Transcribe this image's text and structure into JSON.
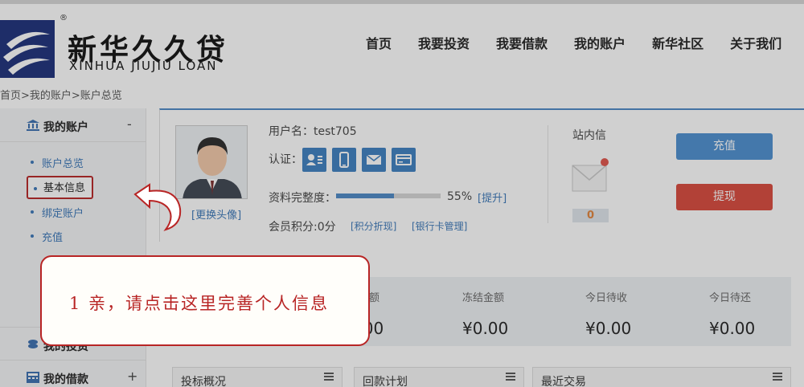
{
  "header": {
    "logo_cn": "新华久久贷",
    "logo_en": "XINHUA JIUJIU LOAN",
    "logo_reg": "®",
    "nav": [
      "首页",
      "我要投资",
      "我要借款",
      "我的账户",
      "新华社区",
      "关于我们"
    ]
  },
  "breadcrumb": "首页>我的账户>账户总览",
  "sidebar": {
    "section_account": "我的账户",
    "section_account_toggle": "-",
    "items": [
      "账户总览",
      "基本信息",
      "绑定账户",
      "充值"
    ],
    "section_invest": "我的投资",
    "section_loan": "我的借款",
    "section_loan_toggle": "+"
  },
  "profile": {
    "username": "用户名：test705",
    "auth_label": "认证：",
    "change_avatar": "[更换头像]",
    "complete_label": "资料完整度：",
    "complete_pct": "55%",
    "complete_value": 0.55,
    "complete_link": "[提升]",
    "points": "会员积分:0分",
    "link_points": "[积分折现]",
    "link_bank": "[银行卡管理]"
  },
  "messages": {
    "label": "站内信",
    "count": "0"
  },
  "buttons": {
    "recharge": "充值",
    "withdraw": "提现"
  },
  "stats": [
    {
      "label": "可用余额",
      "value": "¥0.00"
    },
    {
      "label": "冻结金额",
      "value": "¥0.00"
    },
    {
      "label": "今日待收",
      "value": "¥0.00"
    },
    {
      "label": "今日待还",
      "value": "¥0.00"
    }
  ],
  "boxes": [
    "投标概况",
    "回款计划",
    "最近交易"
  ],
  "note": {
    "text": "1 亲，请点击这里完善个人信息"
  },
  "colors": {
    "primary": "#4c8fd0",
    "danger": "#d9483b",
    "annotation": "#b82525"
  }
}
